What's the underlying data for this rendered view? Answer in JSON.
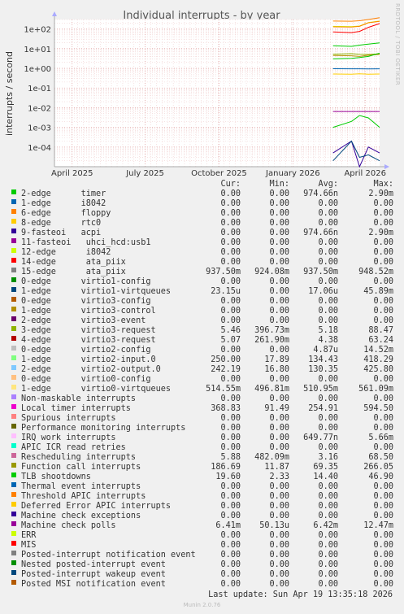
{
  "chart_data": {
    "type": "line",
    "title": "Individual interrupts - by year",
    "ylabel": "interrupts / second",
    "y_scale": "log",
    "ylim": [
      1e-05,
      300
    ],
    "y_ticks": [
      "1e+02",
      "1e+01",
      "1e+00",
      "1e-01",
      "1e-02",
      "1e-03",
      "1e-04"
    ],
    "y_tick_values": [
      100,
      10,
      1,
      0.1,
      0.01,
      0.001,
      0.0001
    ],
    "x_ticks": [
      "April 2025",
      "July 2025",
      "October 2025",
      "January 2026",
      "April 2026"
    ],
    "x_tick_dates": [
      "2025-04-01",
      "2025-07-01",
      "2025-10-01",
      "2026-01-01",
      "2026-04-01"
    ],
    "xlim": [
      "2025-03-10",
      "2026-04-19"
    ],
    "grid": true,
    "series": [
      {
        "name": "2-edge timer",
        "color": "#00cc00",
        "dates": [
          "2026-02-20",
          "2026-03-15",
          "2026-03-25",
          "2026-04-05",
          "2026-04-19"
        ],
        "values": [
          0.001,
          0.002,
          0.004,
          0.003,
          0.001
        ]
      },
      {
        "name": "9-fasteoi acpi",
        "color": "#330099",
        "dates": [
          "2026-02-20",
          "2026-03-15",
          "2026-03-25",
          "2026-04-05",
          "2026-04-19"
        ],
        "values": [
          5e-05,
          0.0002,
          1e-05,
          0.0001,
          5e-05
        ]
      },
      {
        "name": "15-edge ata_piix",
        "color": "#0066b3",
        "dates": [
          "2026-02-20",
          "2026-03-15",
          "2026-03-25",
          "2026-04-05",
          "2026-04-19"
        ],
        "values": [
          0.95,
          0.94,
          0.94,
          0.93,
          0.94
        ]
      },
      {
        "name": "1-edge virtio1-virtqueues",
        "color": "#00487d",
        "dates": [
          "2026-02-20",
          "2026-03-15",
          "2026-03-25",
          "2026-04-05",
          "2026-04-19"
        ],
        "values": [
          2e-05,
          0.0002,
          3e-05,
          4e-05,
          2e-05
        ]
      },
      {
        "name": "3-edge virtio3-request",
        "color": "#8fb300",
        "dates": [
          "2026-02-20",
          "2026-03-15",
          "2026-03-25",
          "2026-04-05",
          "2026-04-19"
        ],
        "values": [
          5.2,
          5.5,
          5.1,
          5.0,
          5.46
        ]
      },
      {
        "name": "4-edge virtio3-request",
        "color": "#b38f00",
        "dates": [
          "2026-02-20",
          "2026-03-15",
          "2026-03-25",
          "2026-04-05",
          "2026-04-19"
        ],
        "values": [
          4.5,
          4.3,
          4.0,
          4.6,
          5.07
        ]
      },
      {
        "name": "1-edge virtio2-input.0",
        "color": "#ccff00",
        "dates": [
          "2026-02-20",
          "2026-03-15",
          "2026-03-25",
          "2026-04-05",
          "2026-04-19"
        ],
        "values": [
          135,
          130,
          140,
          210,
          250
        ]
      },
      {
        "name": "2-edge virtio2-output.0",
        "color": "#ff8000",
        "dates": [
          "2026-02-20",
          "2026-03-15",
          "2026-03-25",
          "2026-04-05",
          "2026-04-19"
        ],
        "values": [
          128,
          125,
          135,
          205,
          242
        ]
      },
      {
        "name": "1-edge virtio0-virtqueues",
        "color": "#ffcc00",
        "dates": [
          "2026-02-20",
          "2026-03-15",
          "2026-03-25",
          "2026-04-05",
          "2026-04-19"
        ],
        "values": [
          0.51,
          0.5,
          0.52,
          0.5,
          0.51
        ]
      },
      {
        "name": "Local timer interrupts",
        "color": "#ff8000",
        "dates": [
          "2026-02-20",
          "2026-03-15",
          "2026-03-25",
          "2026-04-05",
          "2026-04-19"
        ],
        "values": [
          250,
          245,
          260,
          300,
          369
        ]
      },
      {
        "name": "Rescheduling interrupts",
        "color": "#00cc00",
        "dates": [
          "2026-02-20",
          "2026-03-15",
          "2026-03-25",
          "2026-04-05",
          "2026-04-19"
        ],
        "values": [
          3.0,
          3.2,
          3.5,
          4.0,
          5.88
        ]
      },
      {
        "name": "Function call interrupts",
        "color": "#ff0000",
        "dates": [
          "2026-02-20",
          "2026-03-15",
          "2026-03-25",
          "2026-04-05",
          "2026-04-19"
        ],
        "values": [
          70,
          65,
          75,
          120,
          187
        ]
      },
      {
        "name": "TLB shootdowns",
        "color": "#00cc00",
        "dates": [
          "2026-02-20",
          "2026-03-15",
          "2026-03-25",
          "2026-04-05",
          "2026-04-19"
        ],
        "values": [
          14,
          13,
          15,
          17,
          19.6
        ]
      },
      {
        "name": "Machine check polls",
        "color": "#990099",
        "dates": [
          "2026-02-20",
          "2026-03-15",
          "2026-03-25",
          "2026-04-05",
          "2026-04-19"
        ],
        "values": [
          0.0064,
          0.0064,
          0.0064,
          0.0064,
          0.0064
        ]
      }
    ]
  },
  "legend": {
    "headers": {
      "cur": "Cur:",
      "min": "Min:",
      "avg": "Avg:",
      "max": "Max:"
    },
    "rows": [
      {
        "label": "2-edge      timer",
        "color": "#00cc00",
        "cur": "0.00",
        "min": "0.00",
        "avg": "974.66n",
        "max": "2.90m"
      },
      {
        "label": "1-edge      i8042",
        "color": "#0066b3",
        "cur": "0.00",
        "min": "0.00",
        "avg": "0.00",
        "max": "0.00"
      },
      {
        "label": "6-edge      floppy",
        "color": "#ff8000",
        "cur": "0.00",
        "min": "0.00",
        "avg": "0.00",
        "max": "0.00"
      },
      {
        "label": "8-edge      rtc0",
        "color": "#ffcc00",
        "cur": "0.00",
        "min": "0.00",
        "avg": "0.00",
        "max": "0.00"
      },
      {
        "label": "9-fasteoi   acpi",
        "color": "#330099",
        "cur": "0.00",
        "min": "0.00",
        "avg": "974.66n",
        "max": "2.90m"
      },
      {
        "label": "11-fasteoi   uhci_hcd:usb1",
        "color": "#990099",
        "cur": "0.00",
        "min": "0.00",
        "avg": "0.00",
        "max": "0.00"
      },
      {
        "label": "12-edge      i8042",
        "color": "#ccff00",
        "cur": "0.00",
        "min": "0.00",
        "avg": "0.00",
        "max": "0.00"
      },
      {
        "label": "14-edge      ata_piix",
        "color": "#ff0000",
        "cur": "0.00",
        "min": "0.00",
        "avg": "0.00",
        "max": "0.00"
      },
      {
        "label": "15-edge      ata_piix",
        "color": "#808080",
        "cur": "937.50m",
        "min": "924.08m",
        "avg": "937.50m",
        "max": "948.52m"
      },
      {
        "label": "0-edge      virtio1-config",
        "color": "#008f00",
        "cur": "0.00",
        "min": "0.00",
        "avg": "0.00",
        "max": "0.00"
      },
      {
        "label": "1-edge      virtio1-virtqueues",
        "color": "#00487d",
        "cur": "23.15u",
        "min": "0.00",
        "avg": "17.06u",
        "max": "45.89m"
      },
      {
        "label": "0-edge      virtio3-config",
        "color": "#b35a00",
        "cur": "0.00",
        "min": "0.00",
        "avg": "0.00",
        "max": "0.00"
      },
      {
        "label": "1-edge      virtio3-control",
        "color": "#b38f00",
        "cur": "0.00",
        "min": "0.00",
        "avg": "0.00",
        "max": "0.00"
      },
      {
        "label": "2-edge      virtio3-event",
        "color": "#6b006b",
        "cur": "0.00",
        "min": "0.00",
        "avg": "0.00",
        "max": "0.00"
      },
      {
        "label": "3-edge      virtio3-request",
        "color": "#8fb300",
        "cur": "5.46",
        "min": "396.73m",
        "avg": "5.18",
        "max": "88.47"
      },
      {
        "label": "4-edge      virtio3-request",
        "color": "#b30000",
        "cur": "5.07",
        "min": "261.90m",
        "avg": "4.38",
        "max": "63.24"
      },
      {
        "label": "0-edge      virtio2-config",
        "color": "#bebebe",
        "cur": "0.00",
        "min": "0.00",
        "avg": "4.87u",
        "max": "14.52m"
      },
      {
        "label": "1-edge      virtio2-input.0",
        "color": "#80ff80",
        "cur": "250.00",
        "min": "17.89",
        "avg": "134.43",
        "max": "418.29"
      },
      {
        "label": "2-edge      virtio2-output.0",
        "color": "#80c9ff",
        "cur": "242.19",
        "min": "16.80",
        "avg": "130.35",
        "max": "425.80"
      },
      {
        "label": "0-edge      virtio0-config",
        "color": "#ffc080",
        "cur": "0.00",
        "min": "0.00",
        "avg": "0.00",
        "max": "0.00"
      },
      {
        "label": "1-edge      virtio0-virtqueues",
        "color": "#ffe680",
        "cur": "514.55m",
        "min": "496.81m",
        "avg": "510.95m",
        "max": "561.09m"
      },
      {
        "label": "Non-maskable interrupts",
        "color": "#aa80ff",
        "cur": "0.00",
        "min": "0.00",
        "avg": "0.00",
        "max": "0.00"
      },
      {
        "label": "Local timer interrupts",
        "color": "#ee00cc",
        "cur": "368.83",
        "min": "91.49",
        "avg": "254.91",
        "max": "594.50"
      },
      {
        "label": "Spurious interrupts",
        "color": "#ff8080",
        "cur": "0.00",
        "min": "0.00",
        "avg": "0.00",
        "max": "0.00"
      },
      {
        "label": "Performance monitoring interrupts",
        "color": "#666600",
        "cur": "0.00",
        "min": "0.00",
        "avg": "0.00",
        "max": "0.00"
      },
      {
        "label": "IRQ work interrupts",
        "color": "#ffbfff",
        "cur": "0.00",
        "min": "0.00",
        "avg": "649.77n",
        "max": "5.66m"
      },
      {
        "label": "APIC ICR read retries",
        "color": "#00ffcc",
        "cur": "0.00",
        "min": "0.00",
        "avg": "0.00",
        "max": "0.00"
      },
      {
        "label": "Rescheduling interrupts",
        "color": "#cc6699",
        "cur": "5.88",
        "min": "482.09m",
        "avg": "3.16",
        "max": "68.50"
      },
      {
        "label": "Function call interrupts",
        "color": "#999900",
        "cur": "186.69",
        "min": "11.87",
        "avg": "69.35",
        "max": "266.05"
      },
      {
        "label": "TLB shootdowns",
        "color": "#00cc00",
        "cur": "19.60",
        "min": "2.33",
        "avg": "14.40",
        "max": "46.90"
      },
      {
        "label": "Thermal event interrupts",
        "color": "#0066b3",
        "cur": "0.00",
        "min": "0.00",
        "avg": "0.00",
        "max": "0.00"
      },
      {
        "label": "Threshold APIC interrupts",
        "color": "#ff8000",
        "cur": "0.00",
        "min": "0.00",
        "avg": "0.00",
        "max": "0.00"
      },
      {
        "label": "Deferred Error APIC interrupts",
        "color": "#ffcc00",
        "cur": "0.00",
        "min": "0.00",
        "avg": "0.00",
        "max": "0.00"
      },
      {
        "label": "Machine check exceptions",
        "color": "#330099",
        "cur": "0.00",
        "min": "0.00",
        "avg": "0.00",
        "max": "0.00"
      },
      {
        "label": "Machine check polls",
        "color": "#990099",
        "cur": "6.41m",
        "min": "50.13u",
        "avg": "6.42m",
        "max": "12.47m"
      },
      {
        "label": "ERR",
        "color": "#ccff00",
        "cur": "0.00",
        "min": "0.00",
        "avg": "0.00",
        "max": "0.00"
      },
      {
        "label": "MIS",
        "color": "#ff0000",
        "cur": "0.00",
        "min": "0.00",
        "avg": "0.00",
        "max": "0.00"
      },
      {
        "label": "Posted-interrupt notification event",
        "color": "#808080",
        "cur": "0.00",
        "min": "0.00",
        "avg": "0.00",
        "max": "0.00"
      },
      {
        "label": "Nested posted-interrupt event",
        "color": "#008f00",
        "cur": "0.00",
        "min": "0.00",
        "avg": "0.00",
        "max": "0.00"
      },
      {
        "label": "Posted-interrupt wakeup event",
        "color": "#00487d",
        "cur": "0.00",
        "min": "0.00",
        "avg": "0.00",
        "max": "0.00"
      },
      {
        "label": "Posted MSI notification event",
        "color": "#b35a00",
        "cur": "0.00",
        "min": "0.00",
        "avg": "0.00",
        "max": "0.00"
      }
    ]
  },
  "last_update": "Last update: Sun Apr 19 13:35:18 2026",
  "side_label": "RRDTOOL / TOBI OETIKER",
  "footer": "Munin 2.0.76"
}
